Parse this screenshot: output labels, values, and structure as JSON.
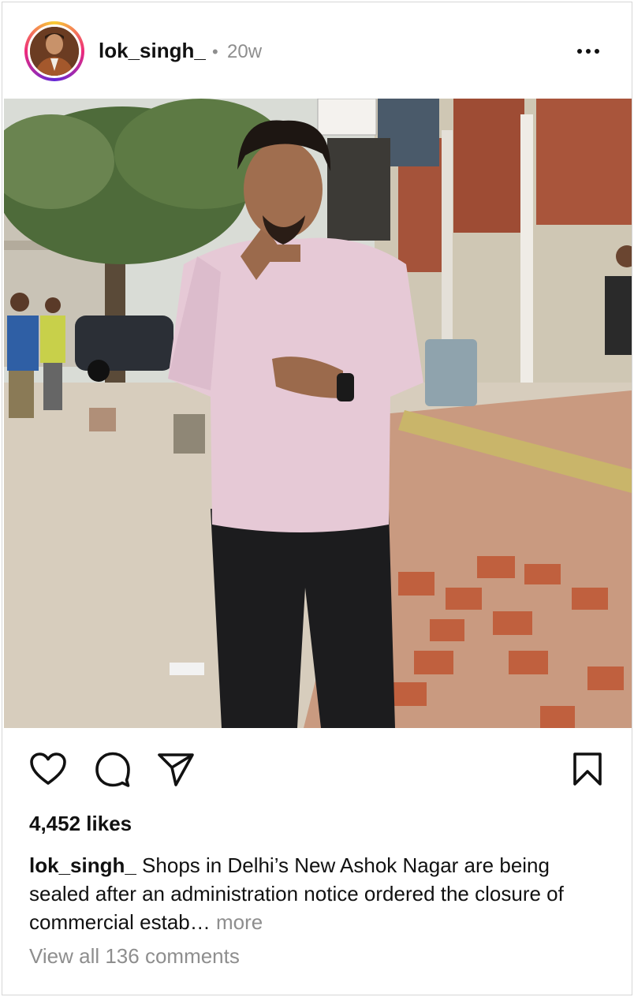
{
  "post": {
    "username": "lok_singh_",
    "separator": "•",
    "age": "20w",
    "likes": "4,452 likes",
    "caption_user": "lok_singh_",
    "caption_text": " Shops in Delhi’s New Ashok Nagar are being sealed after an administration notice ordered the closure of commercial estab…",
    "caption_more": " more",
    "view_comments": "View all 136 comments"
  },
  "icons": {
    "more": "more-horizontal-icon",
    "like": "heart-icon",
    "comment": "comment-icon",
    "share": "send-icon",
    "save": "bookmark-icon"
  },
  "colors": {
    "text": "#111111",
    "muted": "#8e8e8e",
    "border": "#d6d6d6"
  }
}
